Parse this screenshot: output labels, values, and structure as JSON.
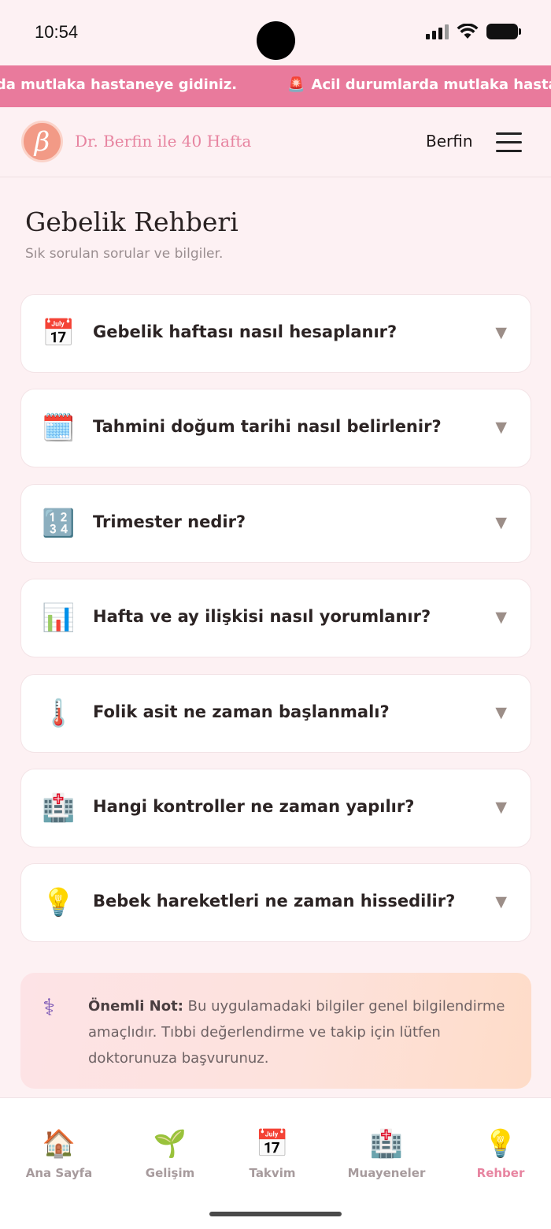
{
  "status_bar": {
    "time": "10:54"
  },
  "alert_banner": {
    "items": [
      {
        "icon": "🚨",
        "text": "Acil durumlarda mutlaka hastaneye gidiniz."
      },
      {
        "icon": "🚨",
        "text": "Acil durumlarda mutlaka hastaneye gidiniz."
      }
    ],
    "partial_text": "rda mutlaka hastaneye gidiniz.",
    "color": "#e97a9c"
  },
  "header": {
    "logo_letter": "β",
    "brand": "Dr. Berfin ile 40 Hafta",
    "user": "Berfin"
  },
  "page": {
    "title": "Gebelik Rehberi",
    "subtitle": "Sık sorulan sorular ve bilgiler."
  },
  "faq": [
    {
      "icon": "📅",
      "icon_name": "calendar-icon",
      "question": "Gebelik haftası nasıl hesaplanır?"
    },
    {
      "icon": "🗓️",
      "icon_name": "spiral-calendar-icon",
      "question": "Tahmini doğum tarihi nasıl belirlenir?"
    },
    {
      "icon": "🔢",
      "icon_name": "numbers-icon",
      "question": "Trimester nedir?"
    },
    {
      "icon": "📊",
      "icon_name": "bar-chart-icon",
      "question": "Hafta ve ay ilişkisi nasıl yorumlanır?"
    },
    {
      "icon": "🌡️",
      "icon_name": "thermometer-icon",
      "question": "Folik asit ne zaman başlanmalı?"
    },
    {
      "icon": "🏥",
      "icon_name": "hospital-icon",
      "question": "Hangi kontroller ne zaman yapılır?"
    },
    {
      "icon": "💡",
      "icon_name": "lightbulb-icon",
      "question": "Bebek hareketleri ne zaman hissedilir?"
    }
  ],
  "faq_chevron": "▼",
  "note": {
    "icon": "⚕",
    "label": "Önemli Not:",
    "text": " Bu uygulamadaki bilgiler genel bilgilendirme amaçlıdır. Tıbbi değerlendirme ve takip için lütfen doktorunuza başvurunuz."
  },
  "bottom_nav": [
    {
      "icon": "🏠",
      "icon_name": "house-icon",
      "label": "Ana Sayfa",
      "active": false
    },
    {
      "icon": "🌱",
      "icon_name": "seedling-icon",
      "label": "Gelişim",
      "active": false
    },
    {
      "icon": "📅",
      "icon_name": "calendar-icon",
      "label": "Takvim",
      "active": false
    },
    {
      "icon": "🏥",
      "icon_name": "hospital-icon",
      "label": "Muayeneler",
      "active": false
    },
    {
      "icon": "💡",
      "icon_name": "lightbulb-icon",
      "label": "Rehber",
      "active": true
    }
  ],
  "colors": {
    "accent": "#e784a0",
    "background": "#fdf1f3"
  }
}
